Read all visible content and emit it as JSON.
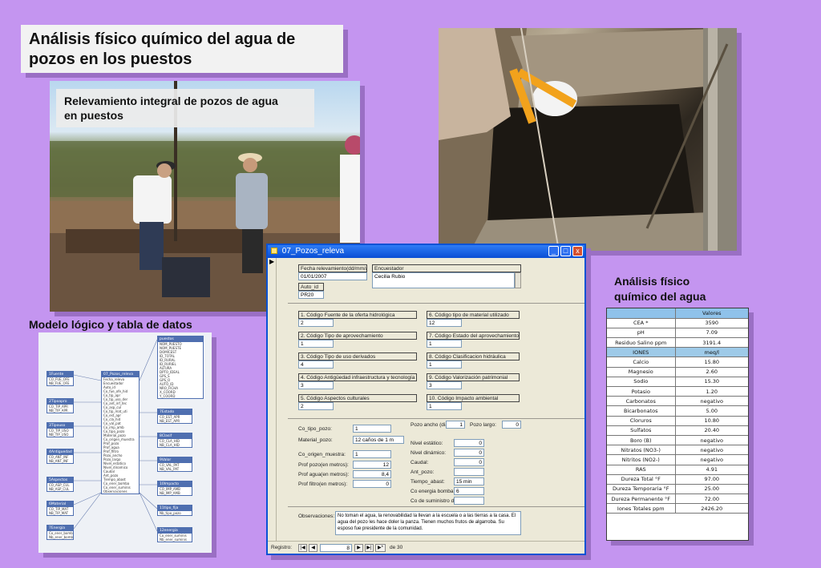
{
  "slide": {
    "title_line1": "Análisis físico químico del agua de",
    "title_line2": "pozos en los puestos",
    "photo_caption_line1": "Relevamiento integral de pozos de agua",
    "photo_caption_line2": "en puestos",
    "diagram_label": "Modelo lógico y tabla de datos",
    "analysis_label_line1": "Análisis físico",
    "analysis_label_line2": "químico del agua"
  },
  "form_window": {
    "title": "07_Pozos_releva",
    "buttons": {
      "minimize": "_",
      "maximize": "□",
      "close": "x"
    },
    "fecha_label": "Fecha relevamiento(dd/mm/aa)",
    "fecha_value": "01/01/2007",
    "auto_label": "Auto_id",
    "auto_value": "PR20",
    "encuestador_label": "Encuestador",
    "encuestador_value": "Cecilia Rubio",
    "codes": [
      {
        "label": "1. Código Fuente de la oferta hidrológica",
        "value": "2"
      },
      {
        "label": "2. Código Tipo de aprovechamiento",
        "value": "1"
      },
      {
        "label": "3. Código Tipo de uso derivados",
        "value": "4"
      },
      {
        "label": "4. Código Antigüedad infraestructura y tecnología",
        "value": "3"
      },
      {
        "label": "5. Código Aspectos culturales",
        "value": "2"
      },
      {
        "label": "6. Código tipo de material utilizado",
        "value": "12"
      },
      {
        "label": "7. Código Estado del aprovechamiento",
        "value": "1"
      },
      {
        "label": "8. Código Clasificacion hidráulica",
        "value": "1"
      },
      {
        "label": "9. Código Valorización patrimonial",
        "value": "3"
      },
      {
        "label": "10. Código Impacto ambiental",
        "value": "1"
      }
    ],
    "left_fields": [
      {
        "label": "Co_tipo_pozo:",
        "value": "1"
      },
      {
        "label": "Material_pozo:",
        "value": "12 caños de 1 m"
      },
      {
        "label": "Co_origen_muestra:",
        "value": "1"
      },
      {
        "label": "Prof pozo(en metros):",
        "value": "12"
      },
      {
        "label": "Prof agua(en metros):",
        "value": "8,4"
      },
      {
        "label": "Prof filtro(en metros):",
        "value": "0"
      }
    ],
    "ancho_label": "Pozo ancho (diámetro:",
    "ancho_value": "1",
    "largo_label": "Pozo largo:",
    "largo_value": "0",
    "right_fields": [
      {
        "label": "Nivel estático:",
        "value": "0"
      },
      {
        "label": "Nivel dinámico:",
        "value": "0"
      },
      {
        "label": "Caudal:",
        "value": "0"
      },
      {
        "label": "Ant_pozo:",
        "value": ""
      },
      {
        "label": "Tiempo_abast:",
        "value": "15 min"
      },
      {
        "label": "Co energia bomba:",
        "value": "6"
      },
      {
        "label": "Co de suministro de energía:",
        "value": ""
      }
    ],
    "observaciones_label": "Observaciones:",
    "observaciones_value": "No toman el agua, la renovabilidad la llevan a la escuela o a las tierras a la casa. El agua del pozo les hace doler la panza. Tienen muchos frutos de algarroba. Su esposo fue presidente de la comunidad.",
    "nav_label": "Registro:",
    "nav_current": "8",
    "nav_total": "de 30",
    "nav_buttons": {
      "first": "|◀",
      "prev": "◀",
      "next": "▶",
      "last": "▶|",
      "new": "▶*"
    }
  },
  "diagram_tables": [
    {
      "name": "1Fuente",
      "rows": [
        "CO_FUE_OFE",
        "NB_FUE_OFE"
      ]
    },
    {
      "name": "2Tipoapro",
      "rows": [
        "CO_TIP_APR",
        "NB_TIP_APR"
      ]
    },
    {
      "name": "3Tipouso",
      "rows": [
        "CO_TIP_USO",
        "NB_TIP_USO"
      ]
    },
    {
      "name": "4Antiguedad",
      "rows": [
        "CO_ANT_INF",
        "NB_ANT_INF"
      ]
    },
    {
      "name": "5Aspectos",
      "rows": [
        "CO_ASP_CUL",
        "NB_ASP_CUL"
      ]
    },
    {
      "name": "6Material",
      "rows": [
        "CO_TIP_MAT",
        "NB_TIP_MAT"
      ]
    },
    {
      "name": "7Energia",
      "rows": [
        "Co_ener_bomba",
        "Nb_ener_bomba"
      ]
    },
    {
      "name": "07_Pozos_releva",
      "rows": [
        "Fecha_releva",
        "Encuestador",
        "Auto_id",
        "Co_fue_ofe_hid",
        "Co_tip_apr",
        "Co_tip_uso_der",
        "Co_ant_inf_tec",
        "Co_asp_cul",
        "Co_tip_mat_uti",
        "Co_est_apr",
        "Co_cla_hid",
        "Co_val_pat",
        "Co_imp_amb",
        "Co_tipo_pozo",
        "Material_pozo",
        "Co_origen_muestra",
        "Prof_pozo",
        "Prof_agua",
        "Prof_filtro",
        "Pozo_ancho",
        "Pozo_largo",
        "Nivel_estatico",
        "Nivel_dinamico",
        "Caudal",
        "Ant_pozo",
        "Tiempo_abast",
        "Co_ener_bomba",
        "Co_ener_suminis",
        "Observaciones"
      ]
    },
    {
      "name": "puestos",
      "rows": [
        "NOM_PUESTO",
        "NOM_PUESTE",
        "DOMICEST",
        "ID_TOTAL",
        "ID_RURAL",
        "ID_RURIEL",
        "ALTURA",
        "DPTO_IDEAL",
        "GPS_S",
        "GPS_O",
        "AUTO_ID",
        "NRO_FICHA",
        "X_COORD",
        "Y_COORD"
      ]
    },
    {
      "name": "7Estado",
      "rows": [
        "CO_EST_APR",
        "NB_EST_APR"
      ]
    },
    {
      "name": "8Clasif",
      "rows": [
        "CO_CLA_HID",
        "NB_CLA_HID"
      ]
    },
    {
      "name": "9Valor",
      "rows": [
        "CO_VAL_PAT",
        "NB_VAL_PAT"
      ]
    },
    {
      "name": "10Impacto",
      "rows": [
        "CO_IMP_AMB",
        "NB_IMP_AMB"
      ]
    },
    {
      "name": "11tipo_fija",
      "rows": [
        "Nb_tipo_pozo"
      ]
    },
    {
      "name": "12energia",
      "rows": [
        "Co_ener_suminis",
        "Nb_ener_suminis"
      ]
    }
  ],
  "water_analysis": {
    "header": "Valores",
    "rows": [
      {
        "param": "CEA *",
        "value": "3590"
      },
      {
        "param": "pH",
        "value": "7.09"
      },
      {
        "param": "Residuo Salino  ppm",
        "value": "3191.4"
      },
      {
        "param": "IONES",
        "value": "meq/l",
        "highlight": true
      },
      {
        "param": "Calcio",
        "value": "15.80"
      },
      {
        "param": "Magnesio",
        "value": "2.60"
      },
      {
        "param": "Sodio",
        "value": "15.30"
      },
      {
        "param": "Potasio",
        "value": "1.20"
      },
      {
        "param": "Carbonatos",
        "value": "negativo"
      },
      {
        "param": "Bicarbonatos",
        "value": "5.00"
      },
      {
        "param": "Cloruros",
        "value": "10.80"
      },
      {
        "param": "Sulfatos",
        "value": "20.40"
      },
      {
        "param": "Boro  (B)",
        "value": "negativo"
      },
      {
        "param": "Nitratos  (NO3-)",
        "value": "negativo"
      },
      {
        "param": "Nitritos  (NO2-)",
        "value": "negativo"
      },
      {
        "param": "RAS",
        "value": "4.91"
      },
      {
        "param": "Dureza Total  °F",
        "value": "97.00"
      },
      {
        "param": "Dureza Temporaria °F",
        "value": "25.00"
      },
      {
        "param": "Dureza Permanente °F",
        "value": "72.00"
      },
      {
        "param": "Iones Totales ppm",
        "value": "2426.20"
      }
    ]
  },
  "colors": {
    "background": "#c495f0",
    "titlebar": "#0a52d4",
    "table_header": "#8fc2ea"
  }
}
